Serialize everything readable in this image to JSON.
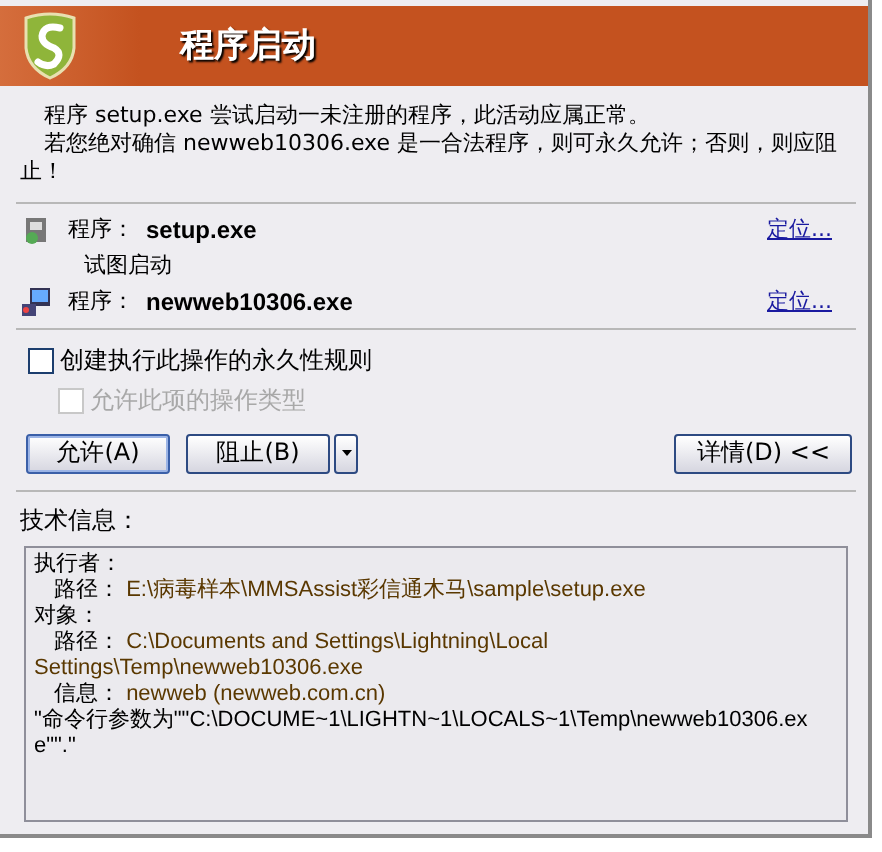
{
  "header": {
    "title": "程序启动"
  },
  "message": [
    "程序 setup.exe 尝试启动一未注册的程序，此活动应属正常。",
    "若您绝对确信 newweb10306.exe 是一合法程序，则可永久允许；否则，则应阻止！"
  ],
  "programs": [
    {
      "kind": "actor",
      "label": "程序：",
      "name": "setup.exe",
      "link": "定位..."
    },
    {
      "kind": "action",
      "text": "试图启动"
    },
    {
      "kind": "target",
      "label": "程序：",
      "name": "newweb10306.exe",
      "link": "定位..."
    }
  ],
  "options": [
    {
      "label": "创建执行此操作的永久性规则",
      "checked": false,
      "disabled": false
    },
    {
      "label": "允许此项的操作类型",
      "checked": false,
      "disabled": true
    }
  ],
  "buttons": [
    {
      "kind": "allow",
      "label": "允许(A)"
    },
    {
      "kind": "block",
      "label": "阻止(B)",
      "menu": true
    },
    {
      "kind": "details",
      "label": "详情(D) <<"
    }
  ],
  "details": {
    "title": "技术信息：",
    "lines": [
      {
        "kind": "heading",
        "text": "执行者："
      },
      {
        "kind": "field",
        "label": "路径：",
        "value": "E:\\病毒样本\\MMSAssist彩信通木马\\sample\\setup.exe"
      },
      {
        "kind": "heading",
        "text": "对象："
      },
      {
        "kind": "field",
        "label": "路径：",
        "value": "C:\\Documents and Settings\\Lightning\\Local Settings\\Temp\\newweb10306.exe"
      },
      {
        "kind": "field",
        "label": "信息：",
        "value": "newweb (newweb.com.cn)"
      },
      {
        "kind": "plain",
        "text": "\"命令行参数为\"\"C:\\DOCUME~1\\LIGHTN~1\\LOCALS~1\\Temp\\newweb10306.exe\"\".\""
      }
    ]
  }
}
